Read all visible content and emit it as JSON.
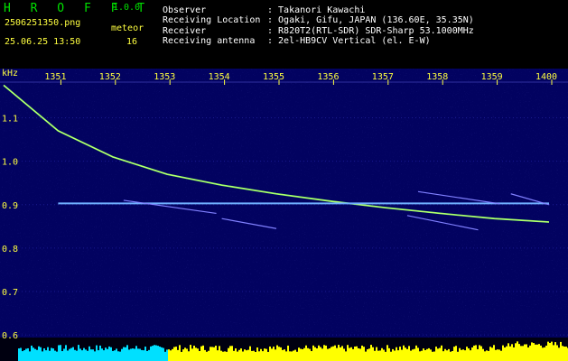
{
  "app": {
    "name": "H R O F F T",
    "version": "1.0.0"
  },
  "file": {
    "name": "2506251350.png",
    "datetime": "25.06.25 13:50"
  },
  "detection": {
    "label": "meteor",
    "count": "16"
  },
  "station": {
    "observer_label": "Observer",
    "observer": ": Takanori Kawachi",
    "location_label": "Receiving Location",
    "location": ": Ogaki, Gifu, JAPAN (136.60E, 35.35N)",
    "receiver_label": "Receiver",
    "receiver": ": R820T2(RTL-SDR) SDR-Sharp 53.1000MHz",
    "antenna_label": "Receiving antenna",
    "antenna": ": 2el-HB9CV Vertical (el. E-W)"
  },
  "chart_data": {
    "type": "heatmap",
    "y_unit": "kHz",
    "x_ticks": [
      "1351",
      "1352",
      "1353",
      "1354",
      "1355",
      "1356",
      "1357",
      "1358",
      "1359",
      "1400"
    ],
    "y_ticks": [
      "1.1",
      "1.0",
      "0.9",
      "0.8",
      "0.7",
      "0.6"
    ],
    "ylim": [
      0.59,
      1.18
    ],
    "traces": [
      {
        "kind": "descending-tone",
        "points": [
          [
            0.0,
            1.175
          ],
          [
            1.0,
            1.07
          ],
          [
            2.0,
            1.01
          ],
          [
            3.0,
            0.97
          ],
          [
            4.0,
            0.945
          ],
          [
            5.0,
            0.925
          ],
          [
            6.0,
            0.908
          ],
          [
            7.0,
            0.893
          ],
          [
            8.0,
            0.88
          ],
          [
            9.0,
            0.868
          ],
          [
            10.0,
            0.86
          ]
        ]
      },
      {
        "kind": "carrier",
        "points": [
          [
            1.0,
            0.903
          ],
          [
            10.0,
            0.903
          ]
        ]
      },
      {
        "kind": "meteor-echo",
        "points": [
          [
            2.2,
            0.91
          ],
          [
            3.9,
            0.88
          ]
        ]
      },
      {
        "kind": "meteor-echo",
        "points": [
          [
            4.0,
            0.868
          ],
          [
            5.0,
            0.845
          ]
        ]
      },
      {
        "kind": "meteor-echo",
        "points": [
          [
            7.4,
            0.875
          ],
          [
            8.7,
            0.842
          ]
        ]
      },
      {
        "kind": "meteor-echo",
        "points": [
          [
            7.6,
            0.93
          ],
          [
            9.1,
            0.902
          ]
        ]
      },
      {
        "kind": "meteor-echo",
        "points": [
          [
            9.3,
            0.925
          ],
          [
            10.0,
            0.9
          ]
        ]
      }
    ]
  },
  "colors": {
    "background": "#020260",
    "axis_text": "#ffff40",
    "header_text": "#ffffff",
    "logo": "#00e000",
    "trace": "#80ff60",
    "carrier": "#70b0ff",
    "bars": "#ffff00",
    "bars_alt": "#00e0ff"
  }
}
